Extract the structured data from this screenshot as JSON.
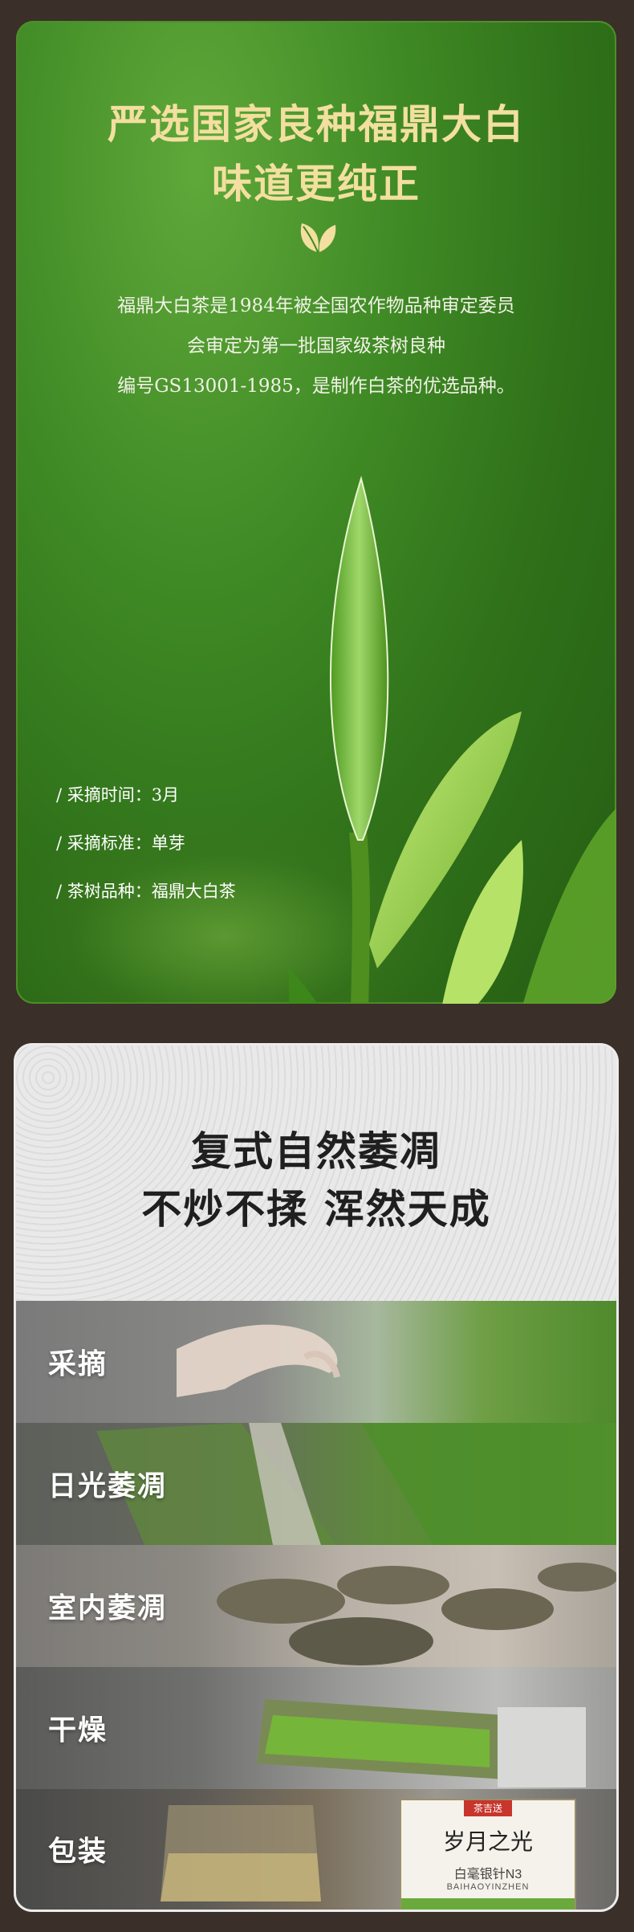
{
  "section1": {
    "title_line1": "严选国家良种福鼎大白",
    "title_line2": "味道更纯正",
    "intro": [
      "福鼎大白茶是1984年被全国农作物品种审定委员",
      "会审定为第一批国家级茶树良种",
      "编号GS13001-1985，是制作白茶的优选品种。"
    ],
    "specs": [
      "/ 采摘时间：3月",
      "/ 采摘标准：单芽",
      "/ 茶树品种：福鼎大白茶"
    ],
    "colors": {
      "title": "#f3dfa0",
      "bg": "#3f8a25"
    }
  },
  "section2": {
    "title_line1": "复式自然萎凋",
    "title_line2": "不炒不揉 浑然天成",
    "steps": [
      "采摘",
      "日光萎凋",
      "室内萎凋",
      "干燥",
      "包装"
    ],
    "package": {
      "badge": "茶吉送",
      "name": "岁月之光",
      "product": "白毫银针N3",
      "pinyin": "BAIHAOYINZHEN"
    }
  }
}
